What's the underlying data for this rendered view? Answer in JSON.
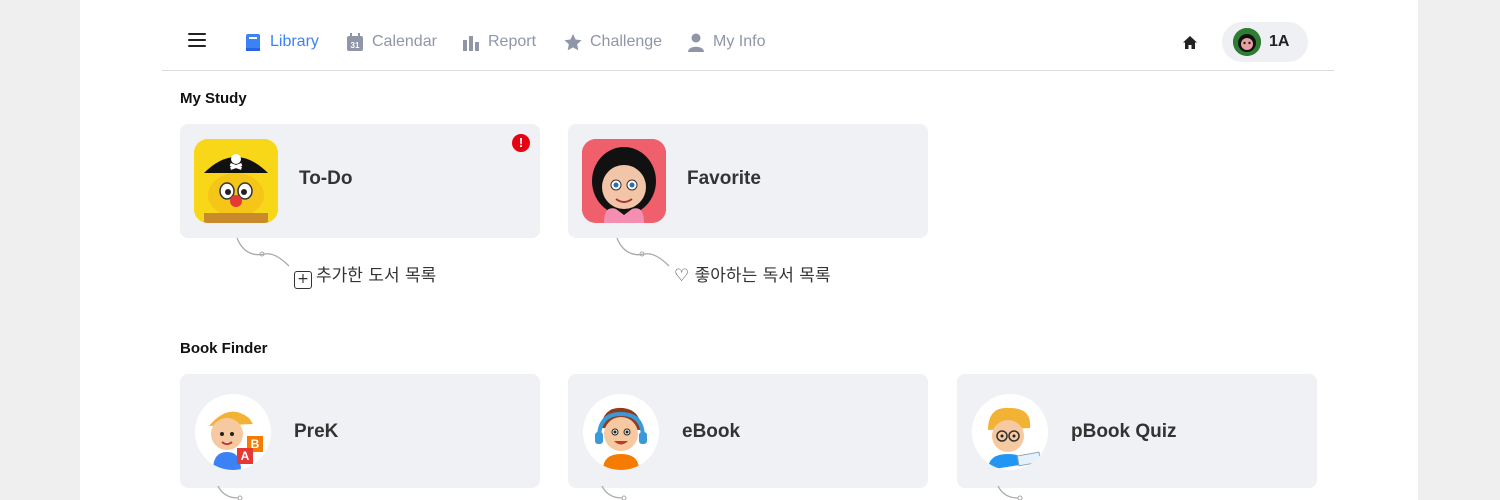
{
  "nav": {
    "items": [
      {
        "label": "Library",
        "icon": "book-icon",
        "active": true
      },
      {
        "label": "Calendar",
        "icon": "calendar-icon",
        "badge": "31"
      },
      {
        "label": "Report",
        "icon": "bar-chart-icon"
      },
      {
        "label": "Challenge",
        "icon": "star-icon"
      },
      {
        "label": "My Info",
        "icon": "person-icon"
      }
    ],
    "user_label": "1A"
  },
  "my_study": {
    "title": "My Study",
    "cards": [
      {
        "label": "To-Do",
        "badge": "!",
        "hint": "추가한 도서 목록",
        "hint_icon": "+"
      },
      {
        "label": "Favorite",
        "hint": "좋아하는 독서 목록",
        "hint_icon": "♡"
      }
    ]
  },
  "book_finder": {
    "title": "Book Finder",
    "cards": [
      {
        "label": "PreK"
      },
      {
        "label": "eBook"
      },
      {
        "label": "pBook Quiz"
      }
    ]
  },
  "colors": {
    "accent": "#3b82f6",
    "nav_inactive": "#8e96a8",
    "card_bg": "#f0f1f5",
    "alert": "#e60012"
  }
}
